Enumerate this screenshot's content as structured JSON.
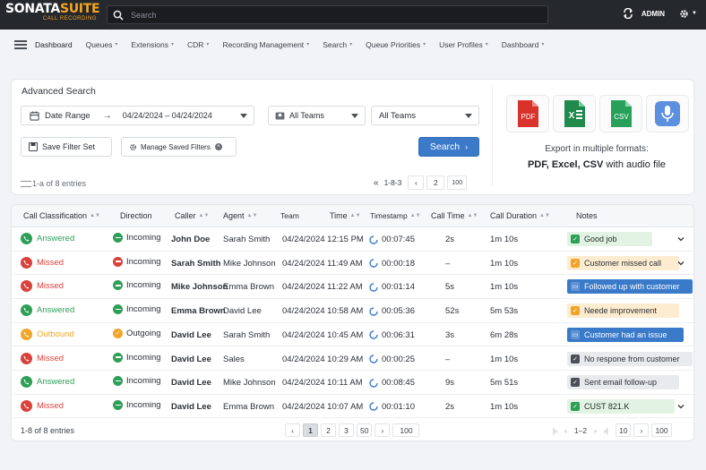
{
  "brand": {
    "name_a": "SONATA",
    "name_b": "SUITE",
    "tagline": "CALL RECORDING"
  },
  "search": {
    "placeholder": "Search"
  },
  "user": {
    "name": "ADMIN"
  },
  "colors": {
    "topbar": "#25282d",
    "primary": "#3a7ac9",
    "answered": "#2e9f57",
    "missed": "#d9423b",
    "outbound": "#f0a52a",
    "note_green": "#e2f3e3",
    "note_orange": "#fdecd0",
    "note_blue": "#3a7ac9",
    "note_gray": "#e8eaee"
  },
  "nav": {
    "items": [
      {
        "label": "Dashboard",
        "active": true
      },
      {
        "label": "Queues"
      },
      {
        "label": "Extensions"
      },
      {
        "label": "CDR"
      },
      {
        "label": "Recording Management"
      },
      {
        "label": "Search"
      },
      {
        "label": "Queue Priorities"
      },
      {
        "label": "User Profiles"
      },
      {
        "label": "Dashboard"
      }
    ]
  },
  "advanced_search": {
    "title": "Advanced Search",
    "date_label": "Date Range",
    "date_value": "04/24/2024 – 04/24/2024",
    "teams_select": "All Teams",
    "teams_select_2": "All Teams",
    "save_filter": "Save Filter Set",
    "manage_filters": "Manage Saved Filters",
    "search_button": "Search",
    "entries": "1-a of 8 entries",
    "range": "1-8-3",
    "page": "2",
    "per_page": "100"
  },
  "export": {
    "icons": [
      "PDF",
      "X",
      "CSV",
      "mic"
    ],
    "text": "Export in multiple formats:",
    "formats": "PDF, Excel, CSV",
    "formats_suffix": " with audio file"
  },
  "table": {
    "headers": {
      "classification": "Call Classification",
      "direction": "Direction",
      "caller": "Caller",
      "agent": "Agent",
      "team": "Team",
      "time": "Time",
      "timestamp": "Timestamp",
      "call_time": "Call Time",
      "duration": "Call Duration",
      "notes": "Notes"
    },
    "rows": [
      {
        "classification": "Answered",
        "cls_type": "answered",
        "direction": "Incoming",
        "dir_type": "in",
        "caller": "John Doe",
        "agent": "Sarah Smith",
        "time": "04/24/2024 12:15 PM",
        "timestamp": "00:07:45",
        "call_time": "2s",
        "duration": "1m 10s",
        "note": "Good job",
        "note_type": "green",
        "expand": true
      },
      {
        "classification": "Missed",
        "cls_type": "missed",
        "direction": "Incoming",
        "dir_type": "missed",
        "caller": "Sarah Smith",
        "agent": "Mike Johnson",
        "time": "04/24/2024 11:49 AM",
        "timestamp": "00:00:18",
        "call_time": "–",
        "duration": "1m 10s",
        "note": "Customer missed call",
        "note_type": "orange",
        "expand": true
      },
      {
        "classification": "Missed",
        "cls_type": "missed",
        "direction": "Incoming",
        "dir_type": "in",
        "caller": "Mike Johnson",
        "agent": "Emma Brown",
        "time": "04/24/2024 11:22 AM",
        "timestamp": "00:01:14",
        "call_time": "5s",
        "duration": "1m 10s",
        "note": "Followed up with customer",
        "note_type": "blue",
        "expand": false
      },
      {
        "classification": "Answered",
        "cls_type": "answered",
        "direction": "Incoming",
        "dir_type": "in",
        "caller": "Emma Brown",
        "agent": "David Lee",
        "time": "04/24/2024 10:58 AM",
        "timestamp": "00:05:36",
        "call_time": "52s",
        "duration": "5m 53s",
        "note": "Neede improvement",
        "note_type": "orange",
        "expand": false
      },
      {
        "classification": "Outbound",
        "cls_type": "outbound",
        "direction": "Outgoing",
        "dir_type": "out",
        "caller": "David Lee",
        "agent": "Sarah Smith",
        "time": "04/24/2024 10:45 AM",
        "timestamp": "00:06:31",
        "call_time": "3s",
        "duration": "6m 28s",
        "note": "Customer had an issue",
        "note_type": "blue",
        "expand": false
      },
      {
        "classification": "Missed",
        "cls_type": "missed",
        "direction": "Incoming",
        "dir_type": "in",
        "caller": "David Lee",
        "agent": "Sales",
        "time": "04/24/2024 10:29 AM",
        "timestamp": "00:00:25",
        "call_time": "–",
        "duration": "1m 10s",
        "note": "No respone from customer",
        "note_type": "gray",
        "expand": false
      },
      {
        "classification": "Answered",
        "cls_type": "answered",
        "direction": "Incoming",
        "dir_type": "in",
        "caller": "David Lee",
        "agent": "Mike Johnson",
        "time": "04/24/2024 10:11 AM",
        "timestamp": "00:08:45",
        "call_time": "9s",
        "duration": "5m 51s",
        "note": "Sent email follow-up",
        "note_type": "gray",
        "expand": false
      },
      {
        "classification": "Missed",
        "cls_type": "missed",
        "direction": "Incoming",
        "dir_type": "in",
        "caller": "David Lee",
        "agent": "Emma Brown",
        "time": "04/24/2024 10:07 AM",
        "timestamp": "00:01:10",
        "call_time": "2s",
        "duration": "1m 10s",
        "note": "CUST 821.K",
        "note_type": "green",
        "expand": true
      }
    ]
  },
  "footer": {
    "count": "1-8 of 8 entries",
    "pages": [
      "1",
      "2",
      "3",
      "50"
    ],
    "current_page": "1",
    "per_page": "100",
    "right_range": "1–2",
    "right_size": "10",
    "right_per_page": "100"
  }
}
